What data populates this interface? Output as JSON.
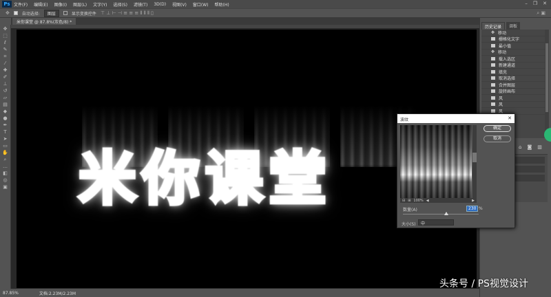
{
  "app": {
    "logo": "Ps"
  },
  "menu": [
    "文件(F)",
    "编辑(E)",
    "图像(I)",
    "图层(L)",
    "文字(Y)",
    "选择(S)",
    "滤镜(T)",
    "3D(D)",
    "视图(V)",
    "窗口(W)",
    "帮助(H)"
  ],
  "options": {
    "auto_select": "自动选择:",
    "layer_select": "图层",
    "show_transform": "显示变换控件"
  },
  "document": {
    "tab": "米你课堂 @ 87.8%(灰色/8) *",
    "artwork_text": "米你课堂"
  },
  "status": {
    "zoom": "87.85%",
    "doc": "文档:2.23M/2.23M"
  },
  "panels": {
    "tabs": [
      "历史记录",
      "调板"
    ],
    "history": [
      "移动",
      "栅格化文字",
      "最小值",
      "移动",
      "载入选区",
      "新建通道",
      "填充",
      "取消选择",
      "合并图层",
      "旋转画布",
      "风",
      "风",
      "风"
    ]
  },
  "dialog": {
    "title": "波纹",
    "ok": "确定",
    "cancel": "取消",
    "zoom": "100%",
    "amount_label": "数量(A)",
    "amount_value": "230",
    "amount_unit": "%",
    "size_label": "大小(S)",
    "size_value": "中"
  },
  "watermark": "头条号 / PS视觉设计"
}
